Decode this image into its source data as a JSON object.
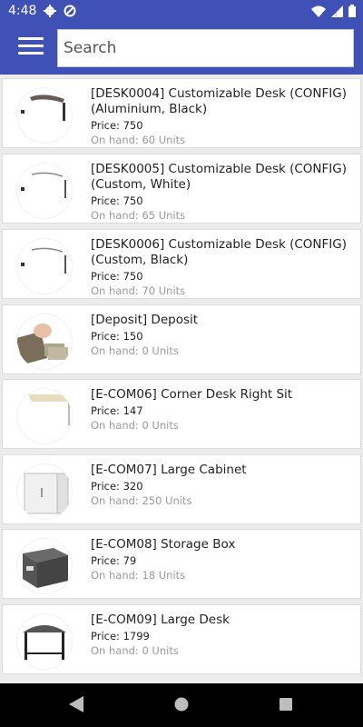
{
  "status": {
    "time": "4:48"
  },
  "search": {
    "placeholder": "Search"
  },
  "products": [
    {
      "title": "[DESK0004] Customizable Desk (CONFIG) (Aluminium, Black)",
      "price": "Price: 750",
      "stock": "On hand: 60 Units",
      "icon": "desk-black-top-image"
    },
    {
      "title": "[DESK0005] Customizable Desk (CONFIG) (Custom, White)",
      "price": "Price: 750",
      "stock": "On hand: 65 Units",
      "icon": "desk-white-image"
    },
    {
      "title": "[DESK0006] Customizable Desk (CONFIG) (Custom, Black)",
      "price": "Price: 750",
      "stock": "On hand: 70 Units",
      "icon": "desk-white-image"
    },
    {
      "title": "[Deposit] Deposit",
      "price": "Price: 150",
      "stock": "On hand: 0 Units",
      "icon": "cash-image"
    },
    {
      "title": "[E-COM06] Corner Desk Right Sit",
      "price": "Price: 147",
      "stock": "On hand: 0 Units",
      "icon": "corner-desk-image"
    },
    {
      "title": "[E-COM07] Large Cabinet",
      "price": "Price: 320",
      "stock": "On hand: 250 Units",
      "icon": "cabinet-image"
    },
    {
      "title": "[E-COM08] Storage Box",
      "price": "Price: 79",
      "stock": "On hand: 18 Units",
      "icon": "storage-box-image"
    },
    {
      "title": "[E-COM09] Large Desk",
      "price": "Price: 1799",
      "stock": "On hand: 0 Units",
      "icon": "large-desk-image"
    }
  ]
}
